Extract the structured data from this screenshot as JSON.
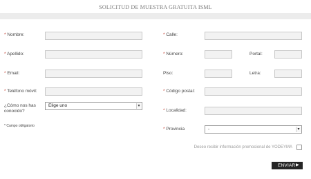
{
  "page": {
    "title": "SOLICITUD DE MUESTRA GRATUITA ISML"
  },
  "required_marker": "*",
  "left": {
    "nombre": {
      "label": "Nombre:",
      "value": ""
    },
    "apellido": {
      "label": "Apellido:",
      "value": ""
    },
    "email": {
      "label": "Email:",
      "value": ""
    },
    "telefono": {
      "label": "Teléfono móvil:",
      "value": ""
    },
    "como": {
      "label": "¿Cómo nos has conocido?",
      "selected": "Elige uno"
    }
  },
  "right": {
    "calle": {
      "label": "Calle:",
      "value": ""
    },
    "numero": {
      "label": "Número:",
      "value": ""
    },
    "portal": {
      "label": "Portal:",
      "value": ""
    },
    "piso": {
      "label": "Piso:",
      "value": ""
    },
    "letra": {
      "label": "Letra:",
      "value": ""
    },
    "codigo_postal": {
      "label": "Código postal:",
      "value": ""
    },
    "localidad": {
      "label": "Localidad:",
      "value": ""
    },
    "provincia": {
      "label": "Provincia",
      "selected": "-"
    }
  },
  "note": {
    "text": "* Campo obligatorio"
  },
  "promo": {
    "label": "Deseo recibir información promocional de YODEYMA",
    "checked": false
  },
  "submit": {
    "label": "ENVIAR",
    "icon": "triangle-right-icon"
  },
  "colors": {
    "button": "#262626",
    "field_bg": "#f2f2f2",
    "band": "#ececec",
    "required": "#c0392b"
  }
}
